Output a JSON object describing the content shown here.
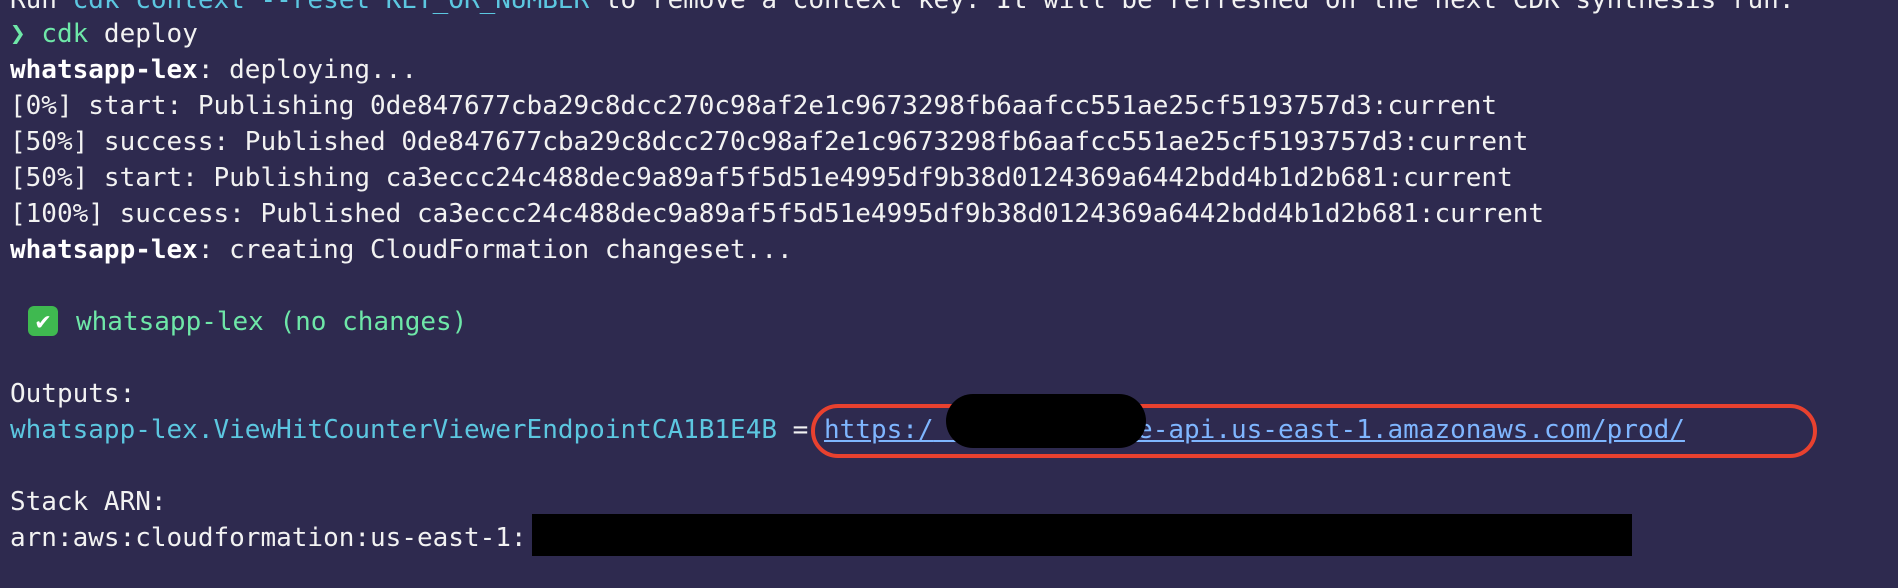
{
  "terminal": {
    "top_line": {
      "prefix": "Run ",
      "command_snippet": "cdk context --reset KEY_OR_NUMBER",
      "suffix": " to remove a context key. It will be refreshed on the next CDK synthesis run."
    },
    "prompt": {
      "glyph": "❯",
      "command": "cdk deploy"
    },
    "lines": [
      {
        "stack": "whatsapp-lex",
        "text": ": deploying..."
      },
      {
        "text": "[0%] start: Publishing 0de847677cba29c8dcc270c98af2e1c9673298fb6aafcc551ae25cf5193757d3:current"
      },
      {
        "text": "[50%] success: Published 0de847677cba29c8dcc270c98af2e1c9673298fb6aafcc551ae25cf5193757d3:current"
      },
      {
        "text": "[50%] start: Publishing ca3eccc24c488dec9a89af5f5d51e4995df9b38d0124369a6442bdd4b1d2b681:current"
      },
      {
        "text": "[100%] success: Published ca3eccc24c488dec9a89af5f5d51e4995df9b38d0124369a6442bdd4b1d2b681:current"
      },
      {
        "stack": "whatsapp-lex",
        "text": ": creating CloudFormation changeset..."
      }
    ],
    "status": {
      "check_glyph": "✔",
      "text": "whatsapp-lex (no changes)"
    },
    "outputs": {
      "heading": "Outputs:",
      "key": "whatsapp-lex.ViewHitCounterViewerEndpointCA1B1E4B",
      "equals": " = ",
      "url_start": "https:/",
      "url_end": "execute-api.us-east-1.amazonaws.com/prod/"
    },
    "stack_arn": {
      "heading": "Stack ARN:",
      "value": "arn:aws:cloudformation:us-east-1:"
    }
  },
  "colors": {
    "background": "#2e2a4f",
    "highlight": "#e8412f",
    "success": "#3fb950"
  }
}
